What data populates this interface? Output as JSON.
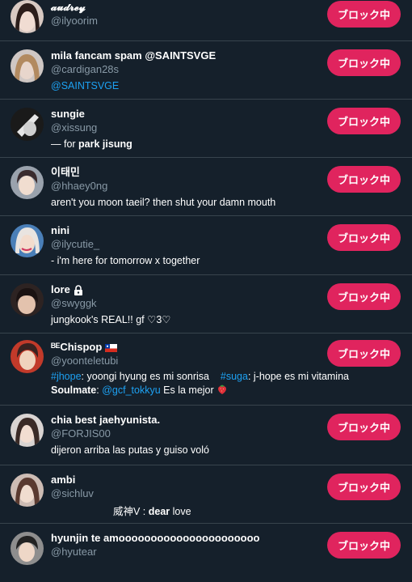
{
  "colors": {
    "background": "#15202b",
    "block_button": "#e0245e",
    "link": "#1da1f2",
    "secondary_text": "#8899a6",
    "divider": "#38444d"
  },
  "block_label": "ブロック中",
  "rows": [
    {
      "name": "𝓪𝓾𝓭𝓻𝓮𝔂",
      "handle": "@ilyoorim",
      "bio": ""
    },
    {
      "name": "mila fancam spam @SAINTSVGE",
      "handle": "@cardigan28s",
      "bio_link": "@SAINTSVGE"
    },
    {
      "name": "sungie",
      "handle": "@xissung",
      "bio_prefix": "— for ",
      "bio_bold": "park jisung"
    },
    {
      "name": "이태민",
      "handle": "@hhaey0ng",
      "bio": "aren't you moon taeil? then shut your damn mouth"
    },
    {
      "name": "nini",
      "handle": "@ilycutie_",
      "bio": "- i'm here for tomorrow x together"
    },
    {
      "name": "lore",
      "handle": "@swyggk",
      "bio": "jungkook's REAL!! gf ♡3♡",
      "icon": "lock-icon"
    },
    {
      "name": "ᴮᴱChispop",
      "handle": "@yoonteletubi",
      "bio_line1": {
        "tag1": "#jhope",
        "text1": ": yoongi hyung es mi sonrisa",
        "tag2": "#suga",
        "text2": ": j-hope es mi vitamina"
      },
      "bio_line2": {
        "bold": "Soulmate",
        "sep": ": ",
        "link": "@gcf_tokkyu",
        "text": " Es la mejor"
      },
      "icon": "chile-flag-icon"
    },
    {
      "name": "chia best jaehyunista.",
      "handle": "@FORJIS00",
      "bio": "dijeron arriba las putas y guiso voló"
    },
    {
      "name": "ambi",
      "handle": "@sichluv",
      "bio_prefix": "威神V : ",
      "bio_bold": "dear",
      "bio_suffix": " love"
    },
    {
      "name": "hyunjin te amoooooooooooooooooooooo",
      "handle": "@hyutear"
    }
  ]
}
